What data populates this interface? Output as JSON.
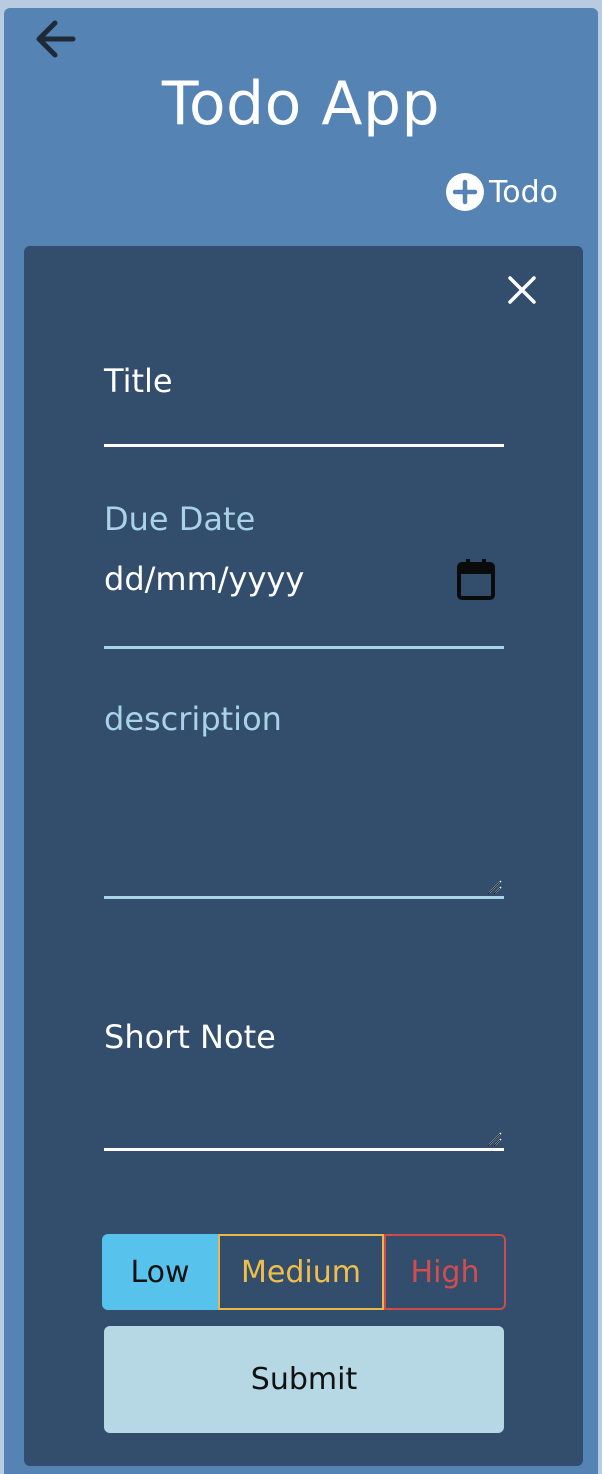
{
  "app": {
    "title": "Todo App",
    "add_label": "Todo"
  },
  "form": {
    "title_label": "Title",
    "due_date_label": "Due Date",
    "due_date_placeholder": "dd/mm/yyyy",
    "description_label": "description",
    "short_note_label": "Short Note",
    "priority": {
      "options": [
        "Low",
        "Medium",
        "High"
      ],
      "selected": "Low"
    },
    "submit_label": "Submit"
  },
  "colors": {
    "background": "#5483b4",
    "panel": "#324e6c",
    "accent_low": "#57c3ec",
    "accent_medium": "#efbf4c",
    "accent_high": "#d24d4d",
    "submit_bg": "#b6d8e4"
  },
  "icons": {
    "back": "arrow-left-icon",
    "add": "plus-circle-icon",
    "close": "close-icon",
    "calendar": "calendar-icon",
    "resize": "resize-handle-icon"
  }
}
